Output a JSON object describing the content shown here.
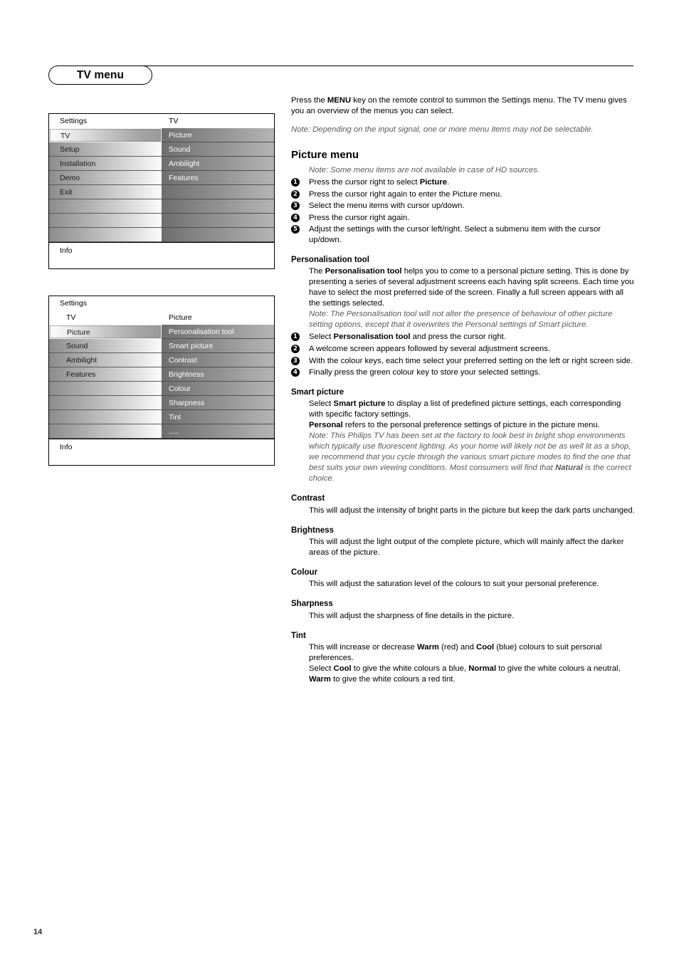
{
  "header": {
    "title": "TV menu"
  },
  "page_number": "14",
  "menu_diagram_1": {
    "header_left": "Settings",
    "header_right": "TV",
    "left_items": [
      "TV",
      "Setup",
      "Installation",
      "Demo",
      "Exit",
      "",
      "",
      ""
    ],
    "right_items": [
      "Picture",
      "Sound",
      "Ambilight",
      "Features",
      "",
      "",
      "",
      ""
    ],
    "selected_left_index": 0,
    "info_label": "Info"
  },
  "menu_diagram_2": {
    "title": "Settings",
    "header_left": "TV",
    "header_right": "Picture",
    "left_items": [
      "Picture",
      "Sound",
      "Ambilight",
      "Features",
      "",
      "",
      "",
      ""
    ],
    "right_items": [
      "Personalisation tool",
      "Smart picture",
      "Contrast",
      "Brightness",
      "Colour",
      "Sharpness",
      "Tint",
      "....."
    ],
    "selected_left_index": 0,
    "info_label": "Info"
  },
  "content": {
    "intro_line1_a": "Press the ",
    "intro_line1_b": "MENU",
    "intro_line1_c": " key on the remote control to summon the Settings menu.",
    "intro_line2": "The TV menu gives you an overview of the menus you can select.",
    "intro_note": "Note: Depending on the input signal, one or more menu items may not be selectable.",
    "picture_menu": {
      "title": "Picture menu",
      "note": "Note: Some menu items are not available in case of HD sources.",
      "steps": [
        {
          "num": "1",
          "pre": "Press the cursor right to select ",
          "bold": "Picture",
          "post": "."
        },
        {
          "num": "2",
          "pre": "Press the cursor right again to enter the Picture menu.",
          "bold": "",
          "post": ""
        },
        {
          "num": "3",
          "pre": "Select the menu items with cursor up/down.",
          "bold": "",
          "post": ""
        },
        {
          "num": "4",
          "pre": "Press the cursor right again.",
          "bold": "",
          "post": ""
        },
        {
          "num": "5",
          "pre": "Adjust the settings with the cursor left/right. Select a submenu item with the cursor up/down.",
          "bold": "",
          "post": ""
        }
      ]
    },
    "personalisation": {
      "title": "Personalisation tool",
      "body_a": "The ",
      "body_b": "Personalisation tool",
      "body_c": " helps you to come to a personal picture setting. This is done by presenting a series of several adjustment screens each having split screens. Each time you have to select the most preferred side of the screen. Finally a full screen appears with all the settings selected.",
      "note": "Note: The Personalisation tool will not alter the presence of behaviour of other picture setting options, except that it overwrites the Personal settings of Smart picture.",
      "steps": [
        {
          "num": "1",
          "pre": "Select ",
          "bold": "Personalisation tool",
          "post": " and press the cursor right."
        },
        {
          "num": "2",
          "pre": "A welcome screen appears followed by several adjustment screens.",
          "bold": "",
          "post": ""
        },
        {
          "num": "3",
          "pre": "With the colour keys, each time select your preferred setting on the left or right screen side.",
          "bold": "",
          "post": ""
        },
        {
          "num": "4",
          "pre": "Finally press the green colour key to store your selected settings.",
          "bold": "",
          "post": ""
        }
      ]
    },
    "smart_picture": {
      "title": "Smart picture",
      "line1_a": "Select ",
      "line1_b": "Smart picture",
      "line1_c": " to display a list of predefined picture settings, each corresponding with specific factory settings.",
      "line2_a": "Personal",
      "line2_b": " refers to the personal preference settings of picture in the picture menu.",
      "note_a": "Note: This Philips TV has been set at the factory to look best in bright shop environments which typically use fluorescent lighting. As your home will likely not be as well lit as a shop, we recommend that you cycle through the various smart picture modes to find the one that best suits your own viewing conditions. Most consumers will find that ",
      "note_b": "Natural",
      "note_c": " is the correct choice."
    },
    "contrast": {
      "title": "Contrast",
      "body": "This will adjust the intensity of bright parts in the picture but keep the dark parts unchanged."
    },
    "brightness": {
      "title": "Brightness",
      "body": "This will adjust the light output of the complete picture, which will mainly affect the darker areas of the picture."
    },
    "colour": {
      "title": "Colour",
      "body": "This will adjust the saturation level of the colours to suit your personal preference."
    },
    "sharpness": {
      "title": "Sharpness",
      "body": "This will adjust the sharpness of fine details in the picture."
    },
    "tint": {
      "title": "Tint",
      "line1_a": "This will increase or decrease ",
      "line1_b": "Warm",
      "line1_c": " (red) and ",
      "line1_d": "Cool",
      "line1_e": " (blue) colours to suit personal preferences.",
      "line2_a": "Select ",
      "line2_b": "Cool",
      "line2_c": " to give the white colours a blue, ",
      "line2_d": "Normal",
      "line2_e": " to give the white colours a neutral, ",
      "line2_f": "Warm",
      "line2_g": " to give the white colours a red tint."
    }
  }
}
